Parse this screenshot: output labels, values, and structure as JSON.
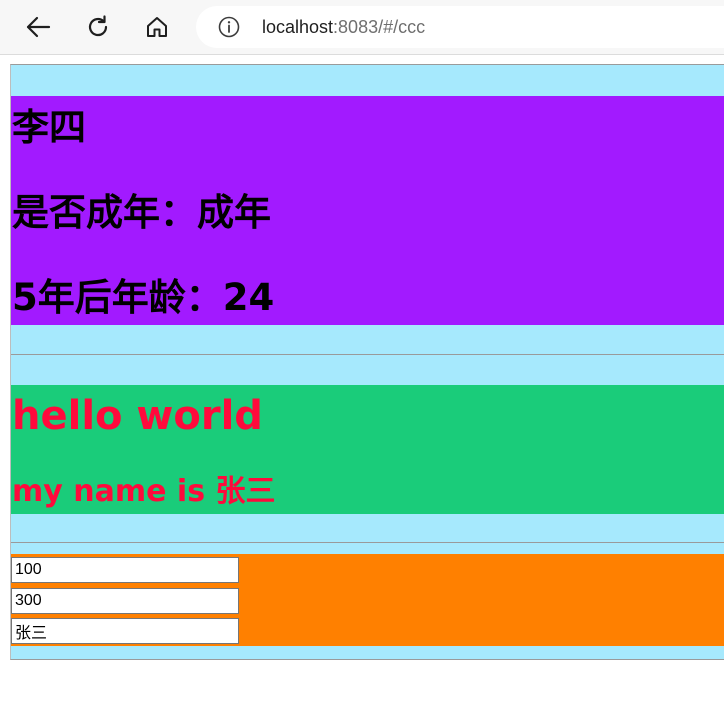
{
  "browser": {
    "url_host": "localhost",
    "url_rest": ":8083/#/ccc",
    "back_icon": "back-arrow-icon",
    "reload_icon": "reload-icon",
    "home_icon": "home-icon",
    "info_icon": "info-icon"
  },
  "person": {
    "name": "李四",
    "adult_line": "是否成年：成年",
    "age_line": "5年后年龄：24"
  },
  "greeting": {
    "title": "hello world",
    "subtitle": "my name is 张三"
  },
  "inputs": {
    "first_value": "100",
    "second_value": "300",
    "third_value": "张三"
  },
  "colors": {
    "page_bg": "#a6e9fd",
    "person_bg": "#a21aff",
    "greeting_bg": "#1acc7a",
    "greeting_text": "#ff0a3c",
    "inputs_bg": "#ff8000"
  }
}
